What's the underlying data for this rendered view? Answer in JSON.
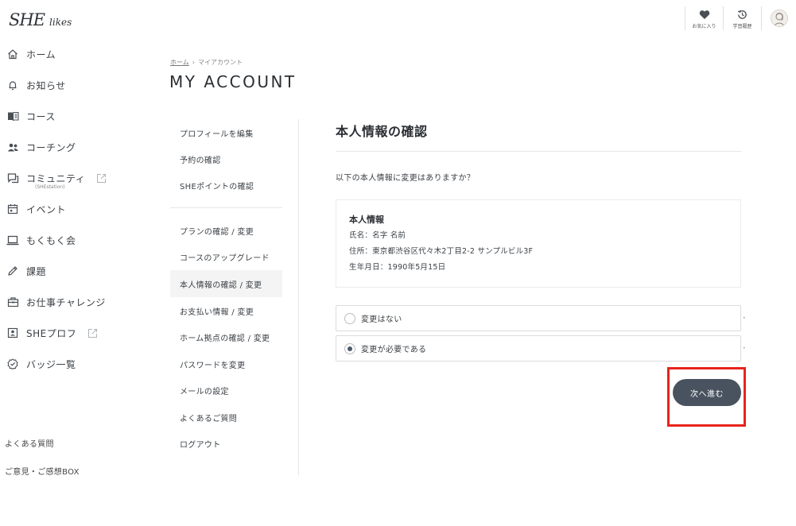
{
  "brand": {
    "logo": "SHE",
    "logo_sub": "likes"
  },
  "header": {
    "actions": [
      {
        "icon": "heart-icon",
        "label": "お気に入り"
      },
      {
        "icon": "history-icon",
        "label": "学習履歴"
      }
    ],
    "avatar_icon": "user-avatar"
  },
  "sidebar": {
    "items": [
      {
        "icon": "home-icon",
        "label": "ホーム"
      },
      {
        "icon": "bell-icon",
        "label": "お知らせ"
      },
      {
        "icon": "book-icon",
        "label": "コース"
      },
      {
        "icon": "people-icon",
        "label": "コーチング"
      },
      {
        "icon": "chat-icon",
        "label": "コミュニティ",
        "sublabel": "(SHEstation)",
        "external": true
      },
      {
        "icon": "calendar-icon",
        "label": "イベント"
      },
      {
        "icon": "laptop-icon",
        "label": "もくもく会"
      },
      {
        "icon": "pencil-icon",
        "label": "課題"
      },
      {
        "icon": "briefcase-icon",
        "label": "お仕事チャレンジ"
      },
      {
        "icon": "id-card-icon",
        "label": "SHEプロフ",
        "external": true
      },
      {
        "icon": "badge-icon",
        "label": "バッジ一覧"
      }
    ],
    "footer": [
      "よくある質問",
      "ご意見・ご感想BOX"
    ]
  },
  "breadcrumb": {
    "home": "ホーム",
    "separator": "›",
    "current": "マイアカウント"
  },
  "page": {
    "title": "MY ACCOUNT"
  },
  "account_menu": {
    "group1": [
      "プロフィールを編集",
      "予約の確認",
      "SHEポイントの確認"
    ],
    "group2": [
      "プランの確認 / 変更",
      "コースのアップグレード",
      "本人情報の確認 / 変更",
      "お支払い情報 / 変更",
      "ホーム拠点の確認 / 変更",
      "パスワードを変更",
      "メールの設定",
      "よくあるご質問",
      "ログアウト"
    ],
    "active": "本人情報の確認 / 変更"
  },
  "main": {
    "title": "本人情報の確認",
    "question": "以下の本人情報に変更はありますか？",
    "info": {
      "title": "本人情報",
      "name_label": "氏名：",
      "name_value": "名字 名前",
      "address_label": "住所：",
      "address_value": "東京都渋谷区代々木2丁目2-2 サンプルビル3F",
      "birth_label": "生年月日：",
      "birth_value": "1990年5月15日"
    },
    "options": [
      {
        "label": "変更はない",
        "selected": false
      },
      {
        "label": "変更が必要である",
        "selected": true
      }
    ],
    "next_button": "次へ進む"
  },
  "colors": {
    "button": "#48535f",
    "highlight": "#e8241b",
    "text": "#3a3f44"
  }
}
